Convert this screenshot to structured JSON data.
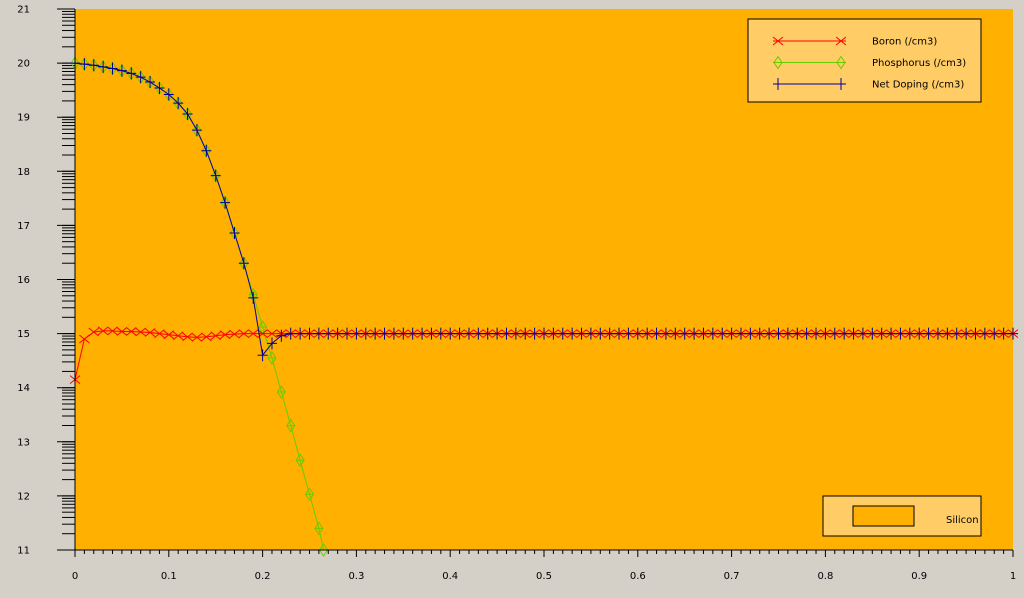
{
  "chart_data": {
    "type": "line",
    "title": "",
    "xlabel": "",
    "ylabel": "",
    "xlim": [
      0,
      1
    ],
    "ylim": [
      11,
      21
    ],
    "x_ticks": [
      "0",
      "0.1",
      "0.2",
      "0.3",
      "0.4",
      "0.5",
      "0.6",
      "0.7",
      "0.8",
      "0.9",
      "1"
    ],
    "y_ticks": [
      "11",
      "12",
      "13",
      "14",
      "15",
      "16",
      "17",
      "18",
      "19",
      "20",
      "21"
    ],
    "legend_position": "top-right",
    "series": [
      {
        "name": "Boron (/cm3)",
        "color": "#ff0000",
        "marker": "x",
        "x": [
          0,
          0.01,
          0.02,
          0.03,
          0.04,
          0.05,
          0.06,
          0.07,
          0.08,
          0.09,
          0.1,
          0.11,
          0.12,
          0.13,
          0.14,
          0.15,
          0.16,
          0.17,
          0.18,
          0.19,
          0.2,
          0.21,
          0.22,
          0.23,
          0.24,
          0.25,
          0.26,
          0.27,
          0.28,
          0.29,
          0.3,
          0.31,
          0.32,
          0.33,
          0.34,
          0.35,
          0.36,
          0.37,
          0.38,
          0.39,
          0.4,
          0.41,
          0.42,
          0.43,
          0.44,
          0.45,
          0.46,
          0.47,
          0.48,
          0.49,
          0.5,
          0.51,
          0.52,
          0.53,
          0.54,
          0.55,
          0.56,
          0.57,
          0.58,
          0.59,
          0.6,
          0.61,
          0.62,
          0.63,
          0.64,
          0.65,
          0.66,
          0.67,
          0.68,
          0.69,
          0.7,
          0.71,
          0.72,
          0.73,
          0.74,
          0.75,
          0.76,
          0.77,
          0.78,
          0.79,
          0.8,
          0.81,
          0.82,
          0.83,
          0.84,
          0.85,
          0.86,
          0.87,
          0.88,
          0.89,
          0.9,
          0.91,
          0.92,
          0.93,
          0.94,
          0.95,
          0.96,
          0.97,
          0.98,
          0.99,
          1.0
        ],
        "y": [
          14.15,
          14.9,
          15.03,
          15.05,
          15.05,
          15.04,
          15.04,
          15.03,
          15.02,
          15.0,
          14.98,
          14.96,
          14.94,
          14.93,
          14.94,
          14.96,
          14.98,
          14.99,
          15.0,
          15.0,
          15.0,
          15.0,
          15.0,
          15.0,
          15.0,
          15.0,
          15.0,
          15.0,
          15.0,
          15.0,
          15.0,
          15.0,
          15.0,
          15.0,
          15.0,
          15.0,
          15.0,
          15.0,
          15.0,
          15.0,
          15.0,
          15.0,
          15.0,
          15.0,
          15.0,
          15.0,
          15.0,
          15.0,
          15.0,
          15.0,
          15.0,
          15.0,
          15.0,
          15.0,
          15.0,
          15.0,
          15.0,
          15.0,
          15.0,
          15.0,
          15.0,
          15.0,
          15.0,
          15.0,
          15.0,
          15.0,
          15.0,
          15.0,
          15.0,
          15.0,
          15.0,
          15.0,
          15.0,
          15.0,
          15.0,
          15.0,
          15.0,
          15.0,
          15.0,
          15.0,
          15.0,
          15.0,
          15.0,
          15.0,
          15.0,
          15.0,
          15.0,
          15.0,
          15.0,
          15.0,
          15.0,
          15.0,
          15.0,
          15.0,
          15.0,
          15.0,
          15.0,
          15.0,
          15.0,
          15.0,
          15.0
        ]
      },
      {
        "name": "Phosphorus (/cm3)",
        "color": "#66cc00",
        "marker": "diamond",
        "x": [
          0,
          0.01,
          0.02,
          0.03,
          0.04,
          0.05,
          0.06,
          0.07,
          0.08,
          0.09,
          0.1,
          0.11,
          0.12,
          0.13,
          0.14,
          0.15,
          0.16,
          0.17,
          0.18,
          0.19,
          0.2,
          0.21,
          0.22,
          0.23,
          0.24,
          0.25,
          0.26,
          0.265
        ],
        "y": [
          20.0,
          19.98,
          19.96,
          19.93,
          19.9,
          19.86,
          19.81,
          19.74,
          19.65,
          19.54,
          19.42,
          19.26,
          19.06,
          18.76,
          18.38,
          17.92,
          17.42,
          16.86,
          16.3,
          15.72,
          15.12,
          14.55,
          13.92,
          13.3,
          12.66,
          12.03,
          11.4,
          11.0
        ]
      },
      {
        "name": "Net Doping (/cm3)",
        "color": "#000099",
        "marker": "plus",
        "x": [
          0,
          0.01,
          0.02,
          0.03,
          0.04,
          0.05,
          0.06,
          0.07,
          0.08,
          0.09,
          0.1,
          0.11,
          0.12,
          0.13,
          0.14,
          0.15,
          0.16,
          0.17,
          0.18,
          0.19,
          0.2,
          0.21,
          0.22,
          0.23,
          0.24,
          0.25,
          0.26,
          0.27,
          0.28,
          0.29,
          0.3,
          0.31,
          0.32,
          0.33,
          0.34,
          0.35,
          0.36,
          0.37,
          0.38,
          0.39,
          0.4,
          0.41,
          0.42,
          0.43,
          0.44,
          0.45,
          0.46,
          0.47,
          0.48,
          0.49,
          0.5,
          0.51,
          0.52,
          0.53,
          0.54,
          0.55,
          0.56,
          0.57,
          0.58,
          0.59,
          0.6,
          0.61,
          0.62,
          0.63,
          0.64,
          0.65,
          0.66,
          0.67,
          0.68,
          0.69,
          0.7,
          0.71,
          0.72,
          0.73,
          0.74,
          0.75,
          0.76,
          0.77,
          0.78,
          0.79,
          0.8,
          0.81,
          0.82,
          0.83,
          0.84,
          0.85,
          0.86,
          0.87,
          0.88,
          0.89,
          0.9,
          0.91,
          0.92,
          0.93,
          0.94,
          0.95,
          0.96,
          0.97,
          0.98,
          0.99,
          1.0
        ],
        "y": [
          20.0,
          19.98,
          19.96,
          19.93,
          19.9,
          19.86,
          19.81,
          19.74,
          19.65,
          19.54,
          19.42,
          19.26,
          19.06,
          18.76,
          18.38,
          17.92,
          17.42,
          16.86,
          16.3,
          15.66,
          14.6,
          14.82,
          14.96,
          15.0,
          15.0,
          15.0,
          15.0,
          15.0,
          15.0,
          15.0,
          15.0,
          15.0,
          15.0,
          15.0,
          15.0,
          15.0,
          15.0,
          15.0,
          15.0,
          15.0,
          15.0,
          15.0,
          15.0,
          15.0,
          15.0,
          15.0,
          15.0,
          15.0,
          15.0,
          15.0,
          15.0,
          15.0,
          15.0,
          15.0,
          15.0,
          15.0,
          15.0,
          15.0,
          15.0,
          15.0,
          15.0,
          15.0,
          15.0,
          15.0,
          15.0,
          15.0,
          15.0,
          15.0,
          15.0,
          15.0,
          15.0,
          15.0,
          15.0,
          15.0,
          15.0,
          15.0,
          15.0,
          15.0,
          15.0,
          15.0,
          15.0,
          15.0,
          15.0,
          15.0,
          15.0,
          15.0,
          15.0,
          15.0,
          15.0,
          15.0,
          15.0,
          15.0,
          15.0,
          15.0,
          15.0,
          15.0,
          15.0,
          15.0,
          15.0,
          15.0,
          15.0
        ]
      }
    ],
    "region_legend": [
      {
        "name": "Silicon",
        "color": "#ffb000"
      }
    ]
  },
  "colors": {
    "window_background": "#d4d0c8",
    "plot_background": "#ffb000",
    "legend_background": "#ffcc66"
  }
}
